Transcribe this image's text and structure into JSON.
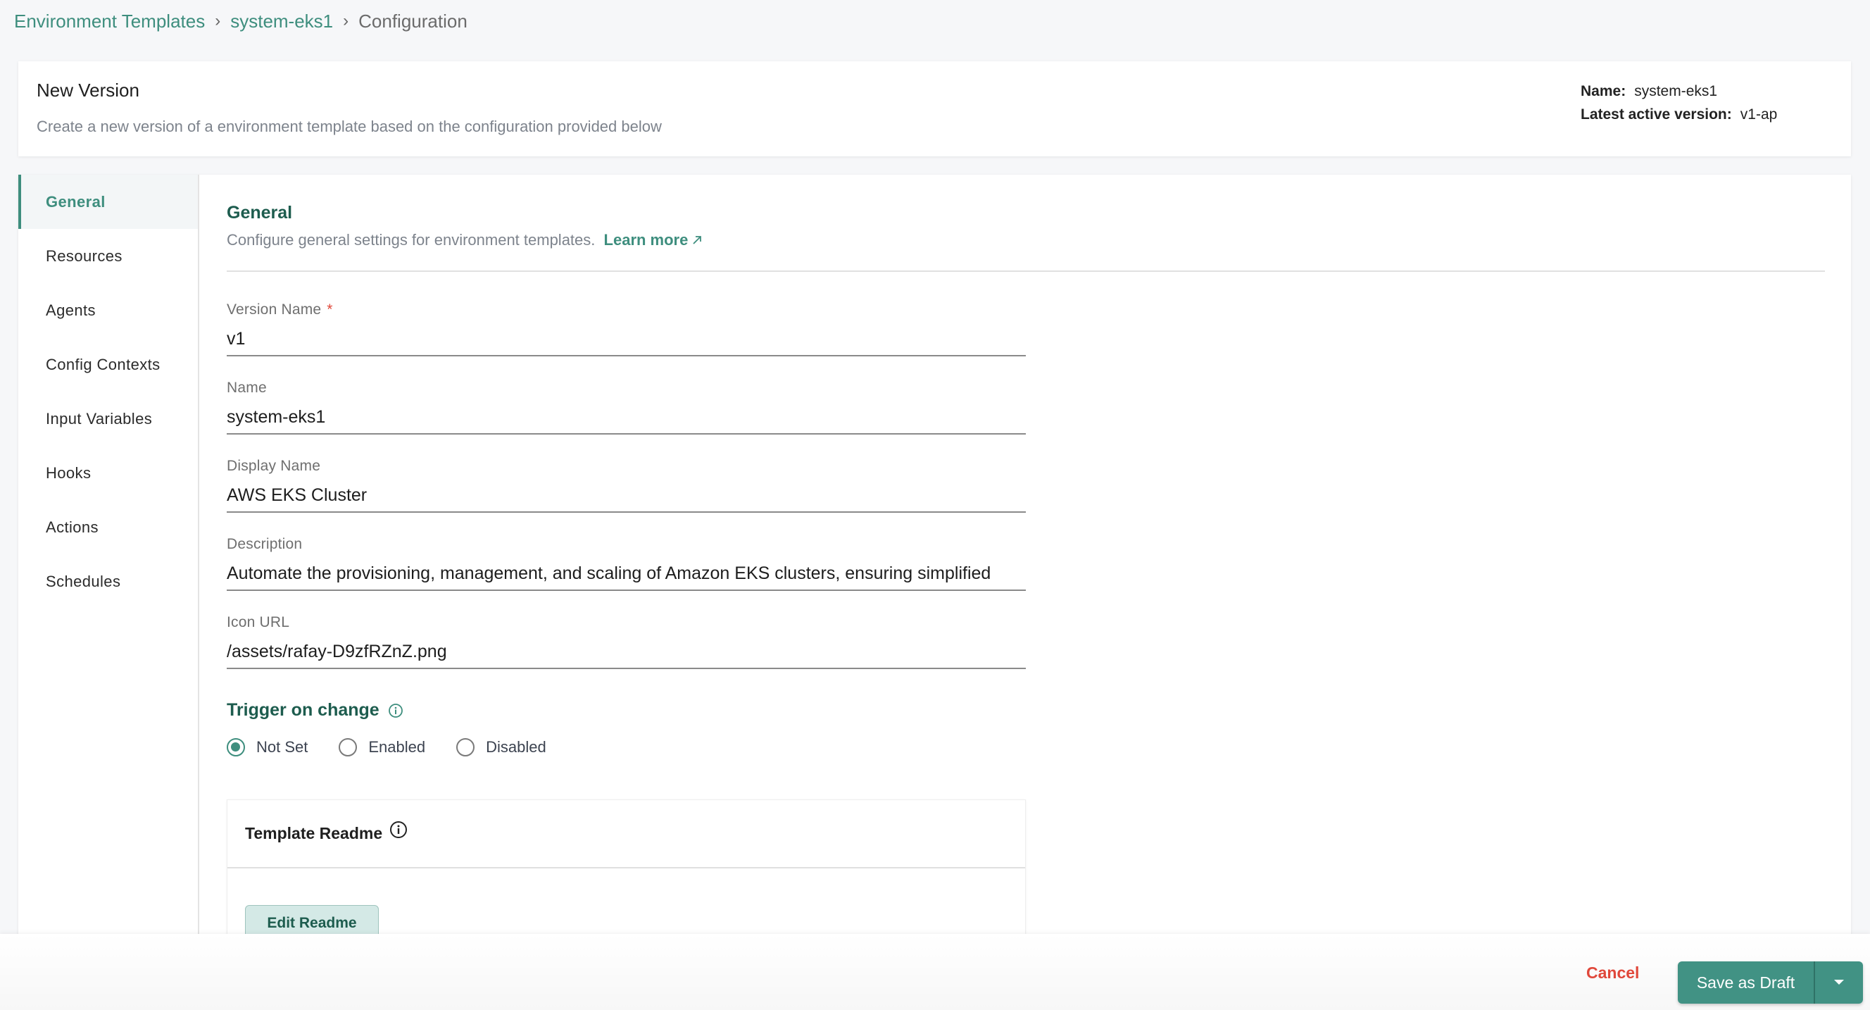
{
  "breadcrumb": {
    "items": [
      {
        "label": "Environment Templates"
      },
      {
        "label": "system-eks1"
      },
      {
        "label": "Configuration"
      }
    ],
    "separator": "›"
  },
  "header": {
    "title": "New Version",
    "subtitle": "Create a new version of a environment template based on the configuration provided below",
    "name_label": "Name:",
    "name_value": "system-eks1",
    "latest_label": "Latest active version:",
    "latest_value": "v1-ap"
  },
  "sidebar": {
    "items": [
      {
        "label": "General",
        "active": true
      },
      {
        "label": "Resources"
      },
      {
        "label": "Agents"
      },
      {
        "label": "Config Contexts"
      },
      {
        "label": "Input Variables"
      },
      {
        "label": "Hooks"
      },
      {
        "label": "Actions"
      },
      {
        "label": "Schedules"
      }
    ]
  },
  "general": {
    "title": "General",
    "description": "Configure general settings for environment templates.",
    "learn_more": "Learn more",
    "fields": {
      "version_name": {
        "label": "Version Name",
        "required_mark": "*",
        "value": "v1"
      },
      "name": {
        "label": "Name",
        "value": "system-eks1"
      },
      "display_name": {
        "label": "Display Name",
        "value": "AWS EKS Cluster"
      },
      "description": {
        "label": "Description",
        "value": "Automate the provisioning, management, and scaling of Amazon EKS clusters, ensuring simplified"
      },
      "icon_url": {
        "label": "Icon URL",
        "value": "/assets/rafay-D9zfRZnZ.png"
      }
    },
    "trigger": {
      "title": "Trigger on change",
      "options": [
        "Not Set",
        "Enabled",
        "Disabled"
      ],
      "selected": "Not Set"
    },
    "readme": {
      "title": "Template Readme",
      "edit_label": "Edit Readme"
    }
  },
  "footer": {
    "cancel_label": "Cancel",
    "save_label": "Save as Draft"
  },
  "colors": {
    "accent": "#3e8e7e",
    "heading": "#1d5c4e",
    "danger": "#e0483b"
  }
}
